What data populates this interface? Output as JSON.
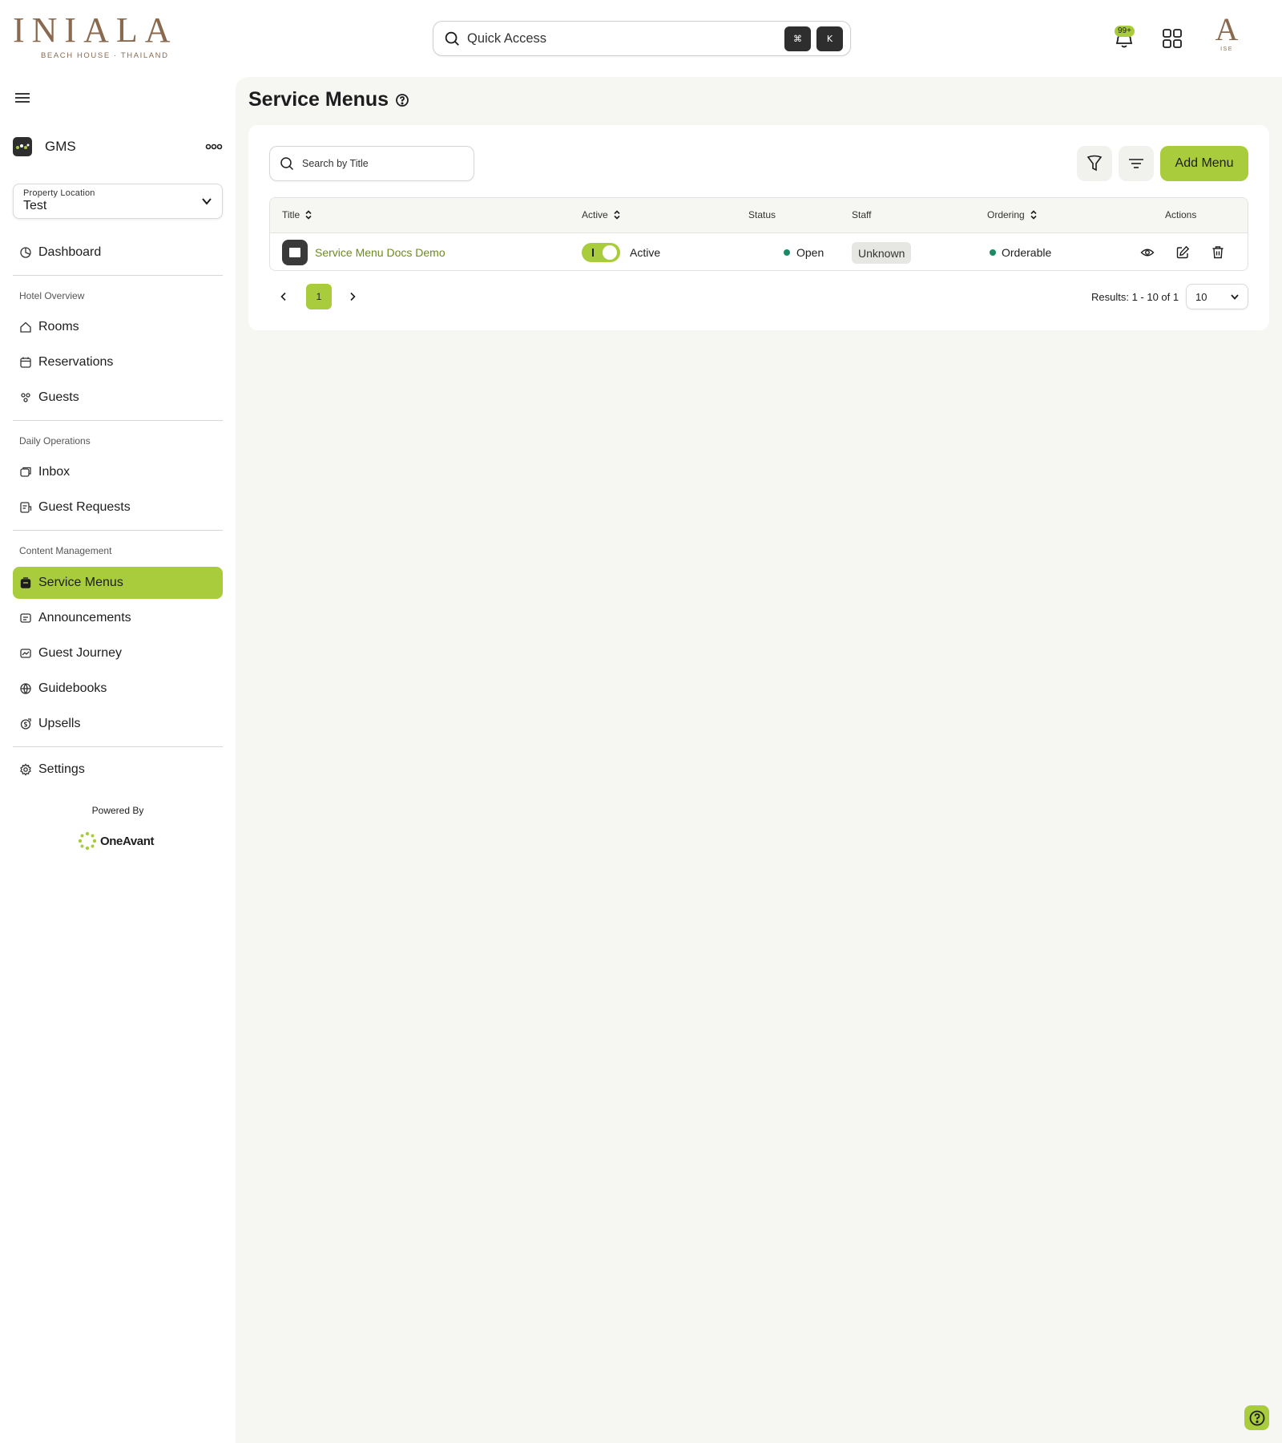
{
  "brand": {
    "logo_word": "INIALA",
    "logo_sub": "BEACH HOUSE · THAILAND",
    "avatar_letter": "A",
    "avatar_sub": "ISE",
    "accent_color": "#a8cc3c",
    "brand_color": "#8a6a4f"
  },
  "header": {
    "quick_access": "Quick Access",
    "shortcut_keys": [
      "⌘",
      "K"
    ],
    "notifications_badge": "99+",
    "icons": [
      "search-icon",
      "bell-icon",
      "apps-grid-icon"
    ]
  },
  "sidebar": {
    "app_name": "GMS",
    "location": {
      "label": "Property Location",
      "value": "Test"
    },
    "dashboard": "Dashboard",
    "sections": [
      {
        "title": "Hotel Overview",
        "items": [
          "Rooms",
          "Reservations",
          "Guests"
        ]
      },
      {
        "title": "Daily Operations",
        "items": [
          "Inbox",
          "Guest Requests"
        ]
      },
      {
        "title": "Content Management",
        "items": [
          "Service Menus",
          "Announcements",
          "Guest Journey",
          "Guidebooks",
          "Upsells"
        ]
      }
    ],
    "active_item": "Service Menus",
    "settings": "Settings",
    "powered_by": "Powered By",
    "powered_brand": "OneAvant"
  },
  "main": {
    "title": "Service Menus",
    "search_placeholder": "Search by Title",
    "add_button": "Add Menu",
    "table": {
      "headers": {
        "title": "Title",
        "active": "Active",
        "status": "Status",
        "staff": "Staff",
        "ordering": "Ordering",
        "actions": "Actions"
      },
      "rows": [
        {
          "title": "Service Menu Docs Demo",
          "active": true,
          "active_label": "Active",
          "status": "Open",
          "staff": "Unknown",
          "ordering": "Orderable"
        }
      ]
    },
    "pagination": {
      "current_page": "1",
      "results": "Results: 1 - 10 of 1",
      "per_page": "10"
    }
  }
}
